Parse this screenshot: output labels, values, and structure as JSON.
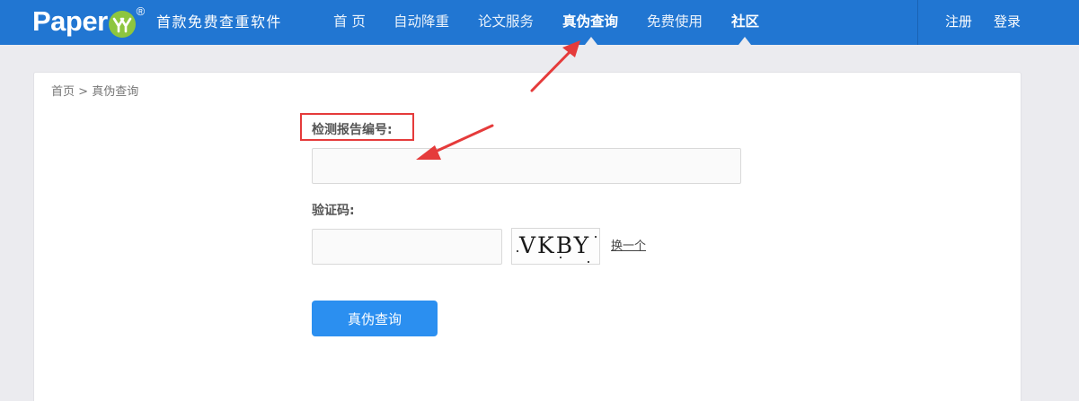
{
  "brand": {
    "logo_text": "Paper",
    "logo_badge_icon": "double-y-icon",
    "logo_reg": "®",
    "slogan": "首款免费查重软件"
  },
  "nav": {
    "items": [
      {
        "label": "首 页"
      },
      {
        "label": "自动降重"
      },
      {
        "label": "论文服务"
      },
      {
        "label": "真伪查询",
        "active": true
      },
      {
        "label": "免费使用"
      },
      {
        "label": "社区"
      }
    ],
    "register": "注册",
    "login": "登录"
  },
  "breadcrumb": {
    "home": "首页",
    "separator": ">",
    "current": "真伪查询"
  },
  "form": {
    "report_label": "检测报告编号:",
    "report_value": "",
    "captcha_label": "验证码:",
    "captcha_value": "",
    "captcha_image_text": "VKBY",
    "refresh_label": "换一个",
    "submit_label": "真伪查询"
  },
  "colors": {
    "navbar": "#2176d2",
    "primary_button": "#2b8ff0",
    "annotation_red": "#e53b3b",
    "logo_badge": "#8dc63f"
  }
}
